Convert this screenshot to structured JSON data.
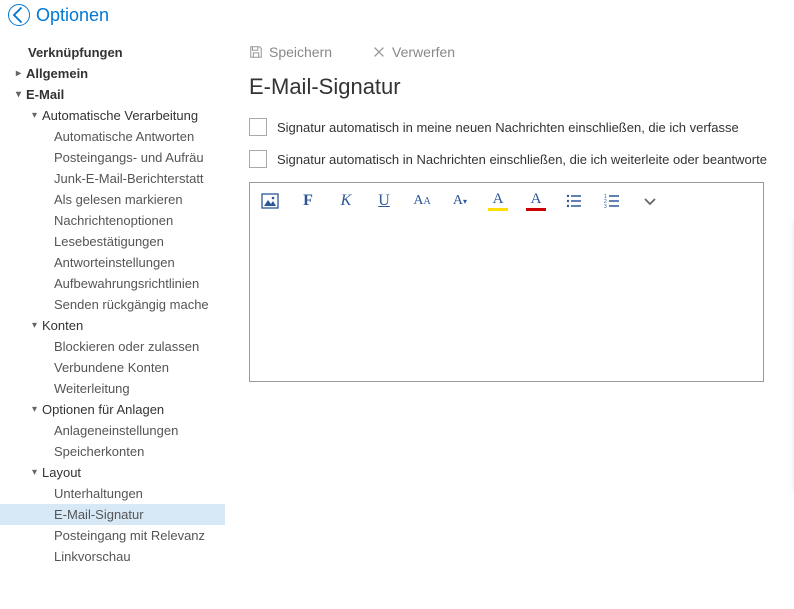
{
  "header": {
    "title": "Optionen"
  },
  "nav": {
    "shortcuts": "Verknüpfungen",
    "general": "Allgemein",
    "email": "E-Mail",
    "auto_processing": "Automatische Verarbeitung",
    "auto_replies": "Automatische Antworten",
    "inbox_rules": "Posteingangs- und Aufräu",
    "junk": "Junk-E-Mail-Berichterstatt",
    "mark_read": "Als gelesen markieren",
    "msg_options": "Nachrichtenoptionen",
    "read_receipts": "Lesebestätigungen",
    "reply_settings": "Antworteinstellungen",
    "retention": "Aufbewahrungsrichtlinien",
    "undo_send": "Senden rückgängig mache",
    "accounts": "Konten",
    "block_allow": "Blockieren oder zulassen",
    "connected": "Verbundene Konten",
    "forwarding": "Weiterleitung",
    "attachments": "Optionen für Anlagen",
    "attach_settings": "Anlageneinstellungen",
    "storage": "Speicherkonten",
    "layout": "Layout",
    "conversations": "Unterhaltungen",
    "signature": "E-Mail-Signatur",
    "focused": "Posteingang mit Relevanz",
    "link_preview": "Linkvorschau"
  },
  "actions": {
    "save": "Speichern",
    "discard": "Verwerfen"
  },
  "page": {
    "title": "E-Mail-Signatur",
    "cb1": "Signatur automatisch in meine neuen Nachrichten einschließen, die ich verfasse",
    "cb2": "Signatur automatisch in Nachrichten einschließen, die ich weiterleite oder beantworte"
  }
}
